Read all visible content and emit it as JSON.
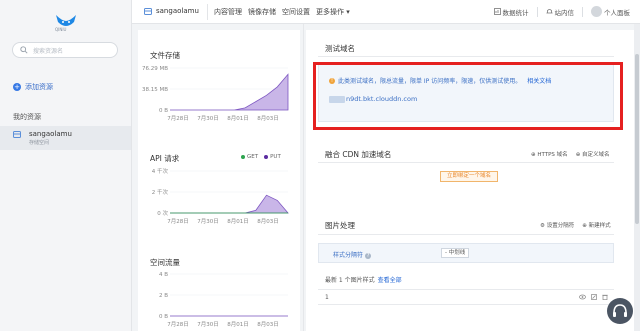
{
  "sidebar": {
    "logo_caption": "QINIU",
    "search_placeholder": "搜索资源名",
    "add_resource": "添加资源",
    "my_resources": "我的资源",
    "bucket": {
      "name": "sangaolamu",
      "type": "存储空间"
    }
  },
  "topbar": {
    "bucket_name": "sangaolamu",
    "tabs": [
      "内容管理",
      "镜像存储",
      "空间设置",
      "更多操作 ▾"
    ],
    "stats": "数据统计",
    "messages": "站内信",
    "user": "个人面板"
  },
  "charts": {
    "storage": {
      "title": "文件存储",
      "chart_data": {
        "type": "area",
        "title": "文件存储",
        "yticks": [
          "76.29 MB",
          "38.15 MB",
          "0 B"
        ],
        "xticks": [
          "7月28日",
          "7月30日",
          "8月01日",
          "8月03日"
        ],
        "values": [
          0,
          0,
          0,
          0,
          0,
          0,
          0,
          0.05,
          0.2,
          0.35,
          0.55,
          0.85
        ]
      }
    },
    "api": {
      "title": "API 请求",
      "legend": [
        "GET",
        "PUT"
      ],
      "colors": {
        "get": "#2ea44f",
        "put": "#5b2ca0"
      },
      "chart_data": {
        "type": "area",
        "title": "API 请求",
        "yticks": [
          "4 千次",
          "2 千次",
          "0 次"
        ],
        "xticks": [
          "7月28日",
          "7月30日",
          "8月01日",
          "8月03日"
        ],
        "series": [
          {
            "name": "GET",
            "values": [
              0,
              0,
              0,
              0,
              0,
              0,
              0,
              0,
              0,
              0,
              0,
              0
            ]
          },
          {
            "name": "PUT",
            "values": [
              0,
              0,
              0,
              0,
              0,
              0,
              0,
              0,
              0.25,
              1.7,
              1.2,
              0
            ]
          }
        ]
      }
    },
    "traffic": {
      "title": "空间流量",
      "chart_data": {
        "type": "area",
        "title": "空间流量",
        "yticks": [
          "4 B",
          "2 B",
          "0 B"
        ],
        "xticks": [
          "7月28日",
          "7月30日",
          "8月01日",
          "8月03日"
        ],
        "values": [
          0,
          0,
          0,
          0,
          0,
          0,
          0,
          0,
          0,
          0,
          0,
          0
        ]
      }
    }
  },
  "test_domain": {
    "title": "测试域名",
    "warning": "此类测试域名，限总流量，限单 IP 访问频率，限速，仅供测试使用。",
    "doc_link": "相关文档",
    "domain": "n9dt.bkt.clouddn.com"
  },
  "cdn": {
    "title": "融合 CDN 加速域名",
    "https_label": "HTTPS 域名",
    "custom_label": "自定义域名",
    "bind_button": "立即绑定一个域名"
  },
  "image": {
    "title": "图片处理",
    "settings_label": "设置分隔符",
    "new_style_label": "新建样式",
    "separator_label": "样式分隔符",
    "separator_value": "- 中划线",
    "recent_text": "最新 1 个图片样式",
    "view_all": "查看全部",
    "row_value": "1"
  }
}
